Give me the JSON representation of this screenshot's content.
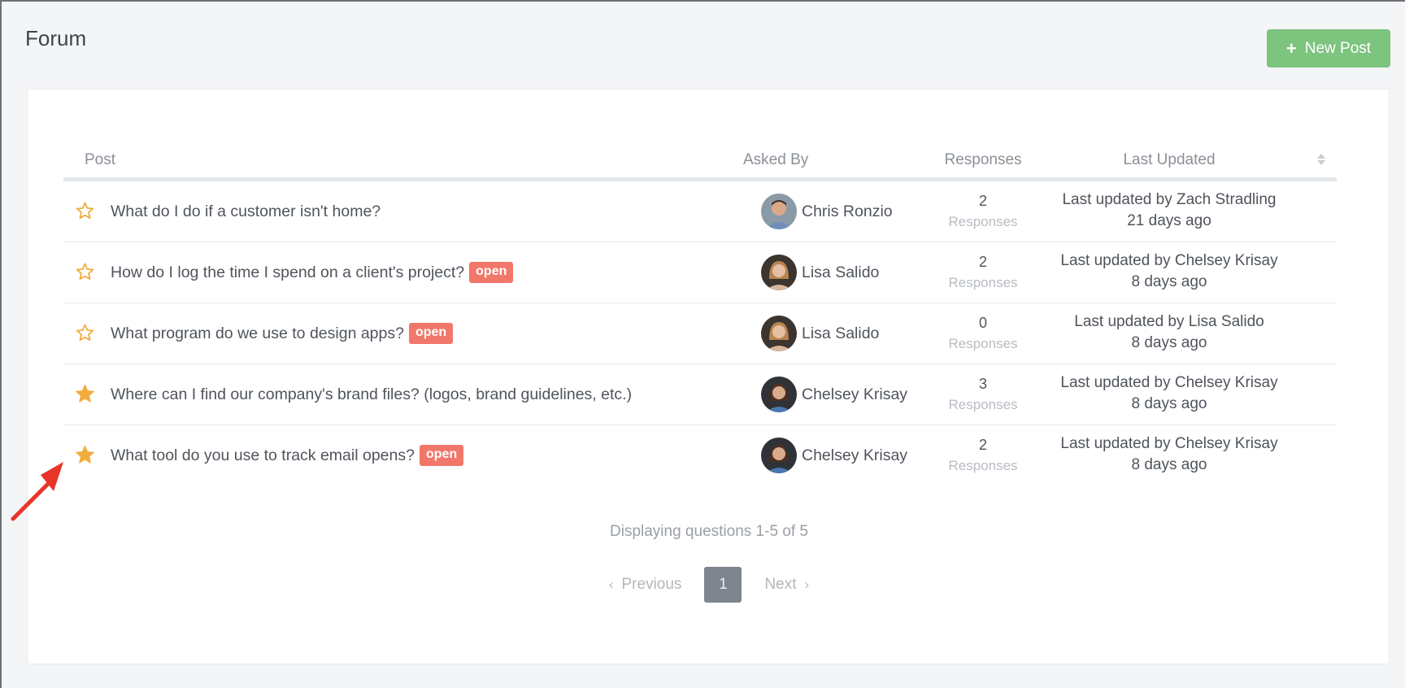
{
  "page": {
    "title": "Forum"
  },
  "toolbar": {
    "new_post_label": "New Post",
    "new_post_icon": "plus-icon",
    "accent": "#7dc47f"
  },
  "table": {
    "columns": {
      "post": "Post",
      "asked_by": "Asked By",
      "responses": "Responses",
      "last_updated": "Last Updated"
    },
    "rows": [
      {
        "starred": false,
        "title": "What do I do if a customer isn't home?",
        "badge": "",
        "asker": "Chris Ronzio",
        "avatar": "man",
        "responses": "2",
        "responses_label": "Responses",
        "last_by": "Last updated by Zach Stradling",
        "last_ago": "21 days ago"
      },
      {
        "starred": false,
        "title": "How do I log the time I spend on a client's project?",
        "badge": "open",
        "asker": "Lisa Salido",
        "avatar": "woman-light",
        "responses": "2",
        "responses_label": "Responses",
        "last_by": "Last updated by Chelsey Krisay",
        "last_ago": "8 days ago"
      },
      {
        "starred": false,
        "title": "What program do we use to design apps?",
        "badge": "open",
        "asker": "Lisa Salido",
        "avatar": "woman-light",
        "responses": "0",
        "responses_label": "Responses",
        "last_by": "Last updated by Lisa Salido",
        "last_ago": "8 days ago"
      },
      {
        "starred": true,
        "title": "Where can I find our company's brand files? (logos, brand guidelines, etc.)",
        "badge": "",
        "asker": "Chelsey Krisay",
        "avatar": "woman-dark",
        "responses": "3",
        "responses_label": "Responses",
        "last_by": "Last updated by Chelsey Krisay",
        "last_ago": "8 days ago"
      },
      {
        "starred": true,
        "title": "What tool do you use to track email opens?",
        "badge": "open",
        "asker": "Chelsey Krisay",
        "avatar": "woman-dark",
        "responses": "2",
        "responses_label": "Responses",
        "last_by": "Last updated by Chelsey Krisay",
        "last_ago": "8 days ago"
      }
    ]
  },
  "footer": {
    "displaying": "Displaying questions 1-5 of 5"
  },
  "pagination": {
    "previous": "Previous",
    "current": "1",
    "next": "Next"
  },
  "colors": {
    "star": "#f0ad3e",
    "badge": "#f1776a",
    "arrow": "#e8352a"
  }
}
